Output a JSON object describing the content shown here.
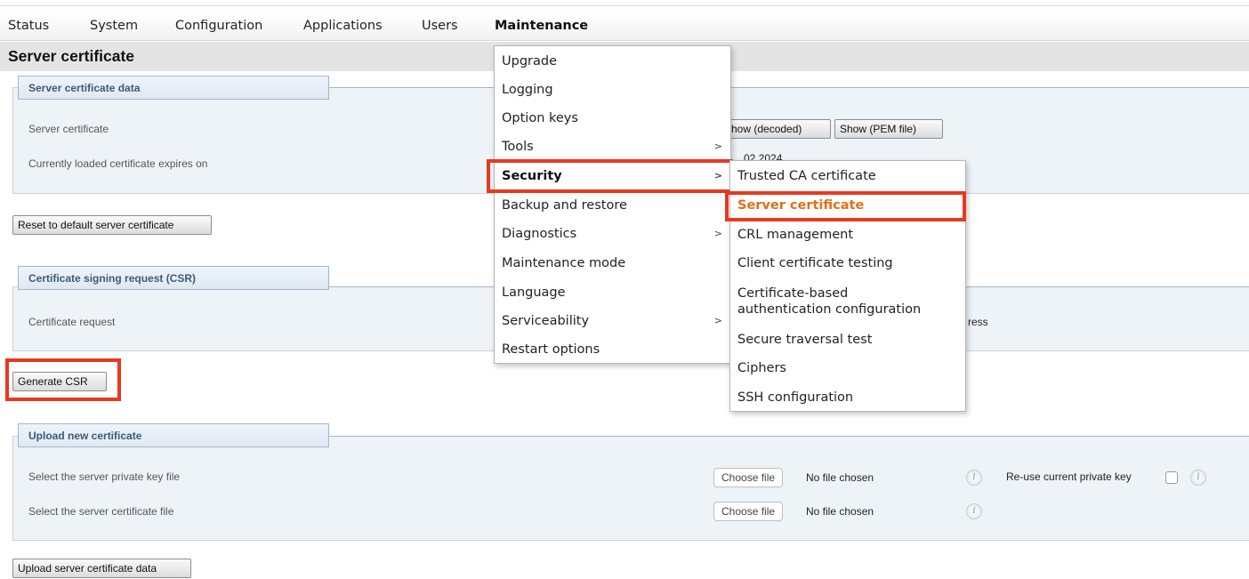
{
  "nav": {
    "items": [
      "Status",
      "System",
      "Configuration",
      "Applications",
      "Users",
      "Maintenance"
    ],
    "active": "Maintenance"
  },
  "page": {
    "title": "Server certificate"
  },
  "server_cert_section": {
    "legend": "Server certificate data",
    "row1_label": "Server certificate",
    "row2_label": "Currently loaded certificate expires on",
    "row2_value_fragment": "...02 2024",
    "show_decoded_label": "Show (decoded)",
    "show_pem_label": "Show (PEM file)"
  },
  "reset_button_label": "Reset to default server certificate",
  "csr_section": {
    "legend": "Certificate signing request (CSR)",
    "row_label": "Certificate request",
    "status_fragment": "ress"
  },
  "generate_csr_label": "Generate CSR",
  "upload_section": {
    "legend": "Upload new certificate",
    "private_key_label": "Select the server private key file",
    "cert_file_label": "Select the server certificate file",
    "choose_file_label": "Choose file",
    "no_file_text": "No file chosen",
    "reuse_key_label": "Re-use current private key"
  },
  "upload_button_label": "Upload server certificate data",
  "maintenance_menu": {
    "items": [
      "Upgrade",
      "Logging",
      "Option keys",
      "Tools",
      "Security",
      "Backup and restore",
      "Diagnostics",
      "Maintenance mode",
      "Language",
      "Serviceability",
      "Restart options"
    ]
  },
  "security_submenu": {
    "items": [
      "Trusted CA certificate",
      "Server certificate",
      "CRL management",
      "Client certificate testing",
      "Certificate-based",
      "authentication configuration",
      "Secure traversal test",
      "Ciphers",
      "SSH configuration"
    ]
  },
  "icons": {
    "submenu_arrow": ">",
    "info": "i"
  },
  "colors": {
    "highlight": "#e8391f",
    "active_menu_text": "#e27014",
    "legend_text": "#3d5a78"
  }
}
